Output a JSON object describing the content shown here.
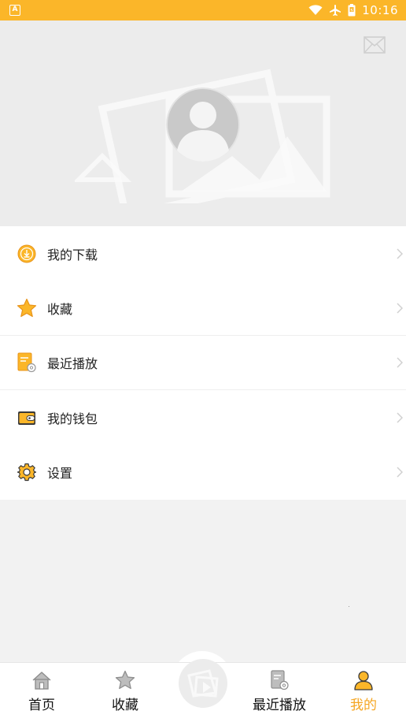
{
  "status_bar": {
    "app_badge": "A",
    "time": "10:16",
    "icons": [
      "wifi-icon",
      "airplane-icon",
      "battery-icon"
    ]
  },
  "header": {
    "icons": [
      "mail-icon",
      "background-picture",
      "avatar-placeholder"
    ]
  },
  "menu": {
    "items": [
      {
        "label": "我的下载",
        "icon": "download-icon"
      },
      {
        "label": "收藏",
        "icon": "star-icon"
      },
      {
        "label": "最近播放",
        "icon": "recent-play-icon"
      },
      {
        "label": "我的钱包",
        "icon": "wallet-icon"
      },
      {
        "label": "设置",
        "icon": "settings-gear-icon"
      }
    ]
  },
  "tabbar": {
    "tabs": [
      {
        "label": "首页",
        "icon": "home-icon"
      },
      {
        "label": "收藏",
        "icon": "star-icon"
      },
      {
        "label": "最近播放",
        "icon": "recent-play-icon"
      },
      {
        "label": "我的",
        "icon": "person-icon",
        "active": true
      }
    ],
    "center_icon": "play-folder-icon"
  },
  "colors": {
    "accent": "#fbb629",
    "active_tab": "#f5a623",
    "header_bg": "#ececec",
    "page_bg": "#f2f2f2"
  }
}
